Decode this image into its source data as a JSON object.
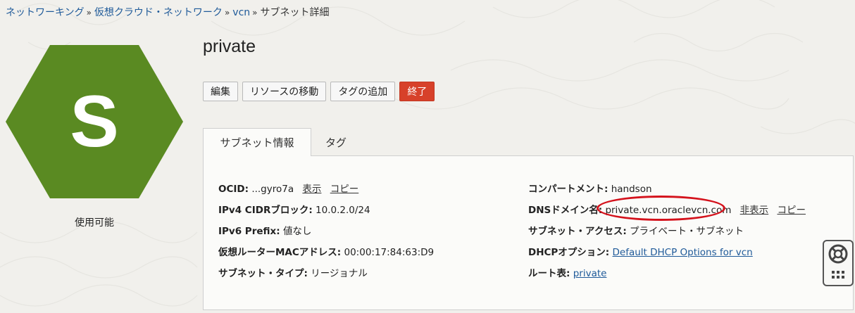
{
  "breadcrumb": {
    "items": [
      "ネットワーキング",
      "仮想クラウド・ネットワーク",
      "vcn"
    ],
    "current": "サブネット詳細",
    "separator": "»"
  },
  "resource": {
    "icon_letter": "S",
    "icon_color": "#5a8a22",
    "status": "使用可能",
    "title": "private"
  },
  "actions": {
    "edit": "編集",
    "move": "リソースの移動",
    "add_tags": "タグの追加",
    "terminate": "終了"
  },
  "tabs": {
    "info": "サブネット情報",
    "tags": "タグ"
  },
  "details": {
    "ocid": {
      "label": "OCID:",
      "value": "...gyro7a",
      "show": "表示",
      "copy": "コピー"
    },
    "ipv4": {
      "label": "IPv4 CIDRブロック:",
      "value": "10.0.2.0/24"
    },
    "ipv6": {
      "label": "IPv6 Prefix:",
      "value": "値なし"
    },
    "mac": {
      "label": "仮想ルーターMACアドレス:",
      "value": "00:00:17:84:63:D9"
    },
    "subnet_type": {
      "label": "サブネット・タイプ:",
      "value": "リージョナル"
    },
    "compartment": {
      "label": "コンパートメント:",
      "value": "handson"
    },
    "dns": {
      "label": "DNSドメイン名:",
      "value": "private.vcn.oraclevcn.com",
      "hide": "非表示",
      "copy": "コピー"
    },
    "access": {
      "label": "サブネット・アクセス:",
      "value": "プライベート・サブネット"
    },
    "dhcp": {
      "label": "DHCPオプション:",
      "value": "Default DHCP Options for vcn"
    },
    "route": {
      "label": "ルート表:",
      "value": "private"
    }
  },
  "colors": {
    "link": "#1f5a99",
    "danger": "#d7412a",
    "annotation": "#d4121c"
  }
}
